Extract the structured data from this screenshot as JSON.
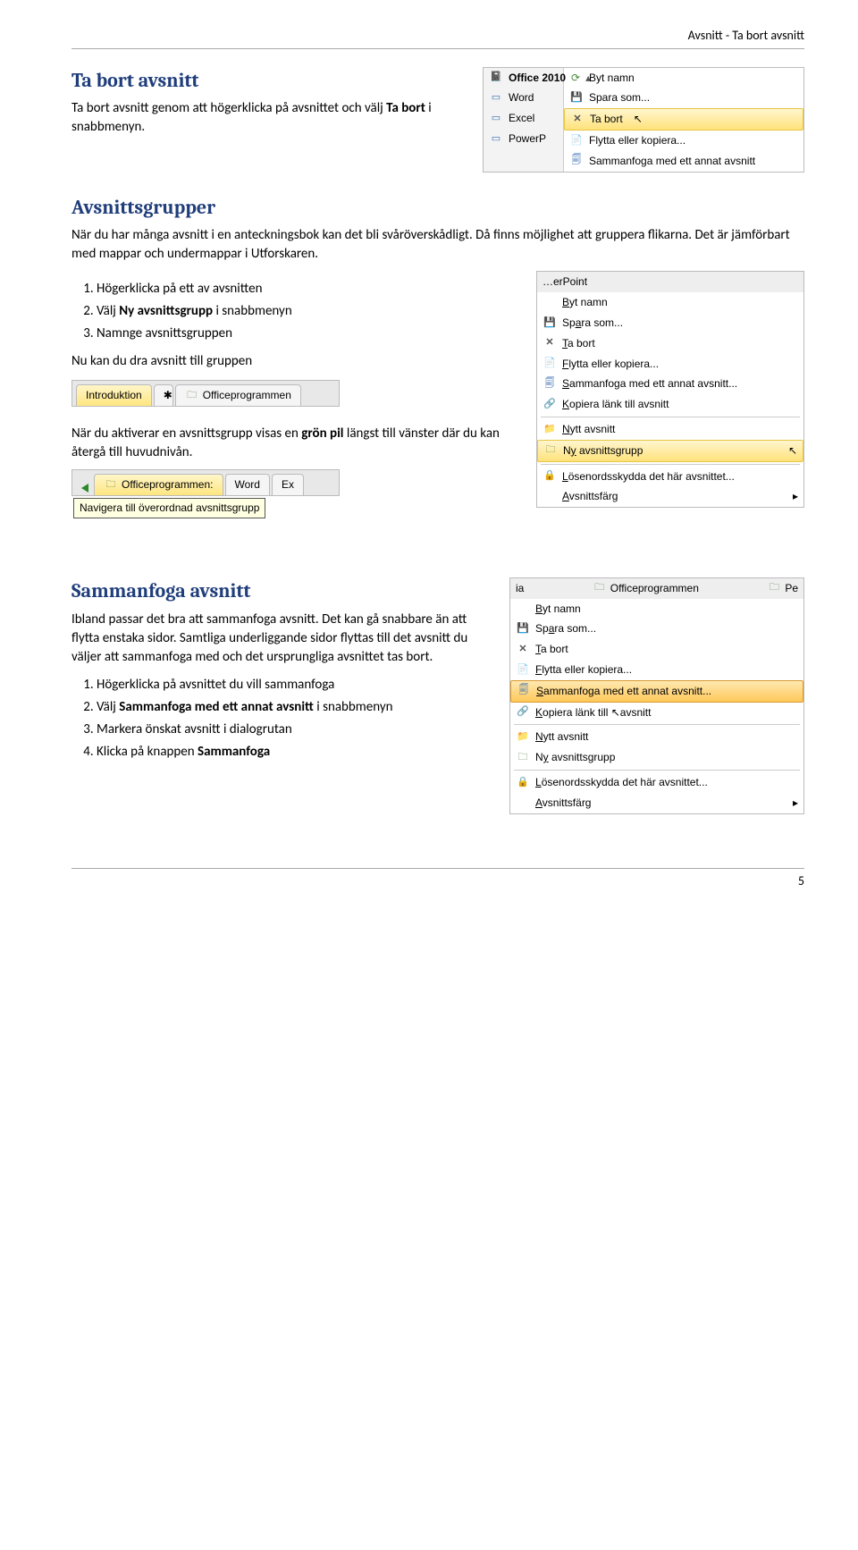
{
  "header": {
    "breadcrumb": "Avsnitt - Ta bort avsnitt"
  },
  "sec1": {
    "title": "Ta bort avsnitt",
    "p_a": "Ta bort avsnitt genom att högerklicka på avsnittet och välj ",
    "p_bold": "Ta bort",
    "p_b": " i snabbmenyn."
  },
  "shot1": {
    "office": "Office 2010",
    "word": "Word",
    "excel": "Excel",
    "powerp": "PowerP",
    "rename": "Byt namn",
    "saveas": "Spara som...",
    "del": "Ta bort",
    "move": "Flytta eller kopiera...",
    "merge": "Sammanfoga med ett annat avsnitt"
  },
  "sec2": {
    "title": "Avsnittsgrupper",
    "p1": "När du har många avsnitt i en anteckningsbok kan det bli svåröverskådligt. Då finns möjlighet att gruppera flikarna. Det är jämförbart med mappar och undermappar i Utforskaren.",
    "s1": "Högerklicka på ett av avsnitten",
    "s2a": "Välj ",
    "s2b": "Ny avsnittsgrupp",
    "s2c": " i snabbmenyn",
    "s3": "Namnge avsnittsgruppen",
    "p2": "Nu kan du dra avsnitt till gruppen",
    "p3a": "När du aktiverar en avsnittsgrupp visas en ",
    "p3b": "grön pil",
    "p3c": " längst till vänster där du kan återgå till huvudnivån."
  },
  "tabs1": {
    "a": "Introduktion",
    "b": "Officeprogrammen"
  },
  "tabs2": {
    "grp": "Officeprogrammen:",
    "word": "Word",
    "ex": "Ex",
    "tooltip": "Navigera till överordnad avsnittsgrupp"
  },
  "shot2": {
    "pp": "…erPoint",
    "rename": "Byt namn",
    "ren_u": "B",
    "saveas": "Spara som...",
    "saveas_u": "a",
    "del": "Ta bort",
    "del_u": "T",
    "move": "Flytta eller kopiera...",
    "move_u": "F",
    "merge": "Sammanfoga med ett annat avsnitt...",
    "merge_u": "S",
    "copylink": "Kopiera länk till avsnitt",
    "copylink_u": "K",
    "newsec": "Nytt avsnitt",
    "newsec_u": "N",
    "newgrp": "Ny avsnittsgrupp",
    "newgrp_u": "y",
    "protect": "Lösenordsskydda det här avsnittet...",
    "protect_u": "L",
    "color": "Avsnittsfärg",
    "color_u": "A"
  },
  "sec3": {
    "title": "Sammanfoga avsnitt",
    "p1": "Ibland passar det bra att sammanfoga avsnitt. Det kan gå snabbare än att flytta enstaka sidor. Samtliga underliggande sidor flyttas till det avsnitt du väljer att sammanfoga med och det ursprungliga avsnittet tas bort.",
    "s1": "Högerklicka på avsnittet du vill sammanfoga",
    "s2a": "Välj ",
    "s2b": "Sammanfoga med ett annat avsnitt",
    "s2c": " i snabbmenyn",
    "s3": "Markera önskat avsnitt i dialogrutan",
    "s4a": "Klicka på knappen ",
    "s4b": "Sammanfoga"
  },
  "shot3": {
    "topa": "ia",
    "topb": "Officeprogrammen",
    "topc": "Pe",
    "rename": "Byt namn",
    "ren_u": "B",
    "saveas": "Spara som...",
    "saveas_u": "a",
    "del": "Ta bort",
    "del_u": "T",
    "move": "Flytta eller kopiera...",
    "move_u": "F",
    "merge": "Sammanfoga med ett annat avsnitt...",
    "merge_u": "S",
    "copylink": "Kopiera länk till avsnitt",
    "copylink_u": "K",
    "newsec": "Nytt avsnitt",
    "newsec_u": "N",
    "newgrp": "Ny avsnittsgrupp",
    "newgrp_u": "y",
    "protect": "Lösenordsskydda det här avsnittet...",
    "protect_u": "L",
    "color": "Avsnittsfärg",
    "color_u": "A"
  },
  "footer": {
    "page": "5"
  }
}
